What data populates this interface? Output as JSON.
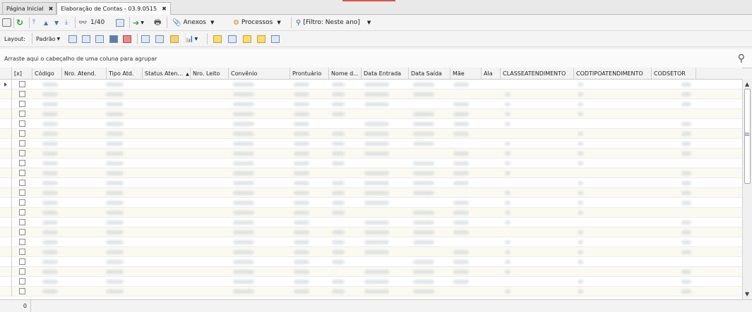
{
  "tabs": [
    {
      "label": "Página Inicial",
      "close": "✖"
    },
    {
      "label": "Elaboração de Contas - 03.9.0515",
      "close": "✖"
    }
  ],
  "toolbar1": {
    "page_indicator": "1/40",
    "anexos_label": "Anexos",
    "processos_label": "Processos",
    "filter_label": "[Filtro: Neste ano]"
  },
  "toolbar2": {
    "layout_label": "Layout:",
    "layout_value": "Padrão"
  },
  "grid": {
    "group_hint": "Arraste aqui o cabeçalho de uma coluna para agrupar",
    "columns": [
      "[x]",
      "Código",
      "Nro. Atend.",
      "Tipo Atd.",
      "Status Aten...",
      "Nro. Leito",
      "Convênio",
      "Prontuário",
      "Nome d...",
      "Data Entrada",
      "Data Saída",
      "Mãe",
      "Ala",
      "CLASSEATENDIMENTO",
      "CODTIPOATENDIMENTO",
      "CODSETOR"
    ],
    "row_count_label": "0"
  },
  "colors": {
    "accent": "#d9534f",
    "highlight": "#f5de6c"
  }
}
